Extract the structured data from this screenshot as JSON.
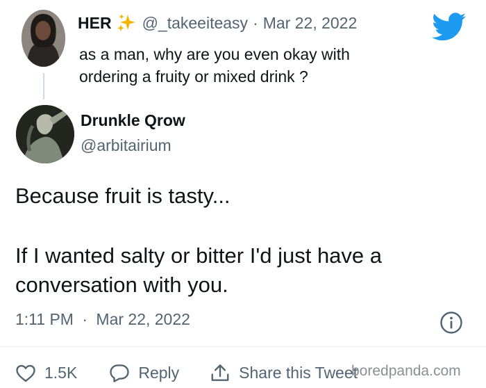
{
  "parent_tweet": {
    "display_name": "HER",
    "emoji": "sparkles",
    "handle": "@_takeeiteasy",
    "separator": "·",
    "date": "Mar 22, 2022",
    "text_line_1": "as a man, why are you even okay with",
    "text_line_2": "ordering a fruity or mixed drink ?"
  },
  "reply_tweet": {
    "display_name": "Drunkle Qrow",
    "handle": "@arbitairium",
    "body": [
      "Because fruit is tasty...",
      "If I wanted salty or bitter I'd just have a",
      "conversation with you."
    ],
    "time": "1:11 PM",
    "separator": "·",
    "date": "Mar 22, 2022"
  },
  "actions": {
    "like_count": "1.5K",
    "reply_label": "Reply",
    "share_label": "Share this Tweet"
  },
  "watermark": "boredpanda.com",
  "colors": {
    "twitter_blue": "#1d9bf0",
    "text_primary": "#0f1419",
    "text_secondary": "#536471",
    "sparkle": "#f4b400"
  },
  "icons": [
    "twitter-bird-icon",
    "sparkles-icon",
    "info-icon",
    "heart-icon",
    "reply-bubble-icon",
    "share-icon"
  ]
}
